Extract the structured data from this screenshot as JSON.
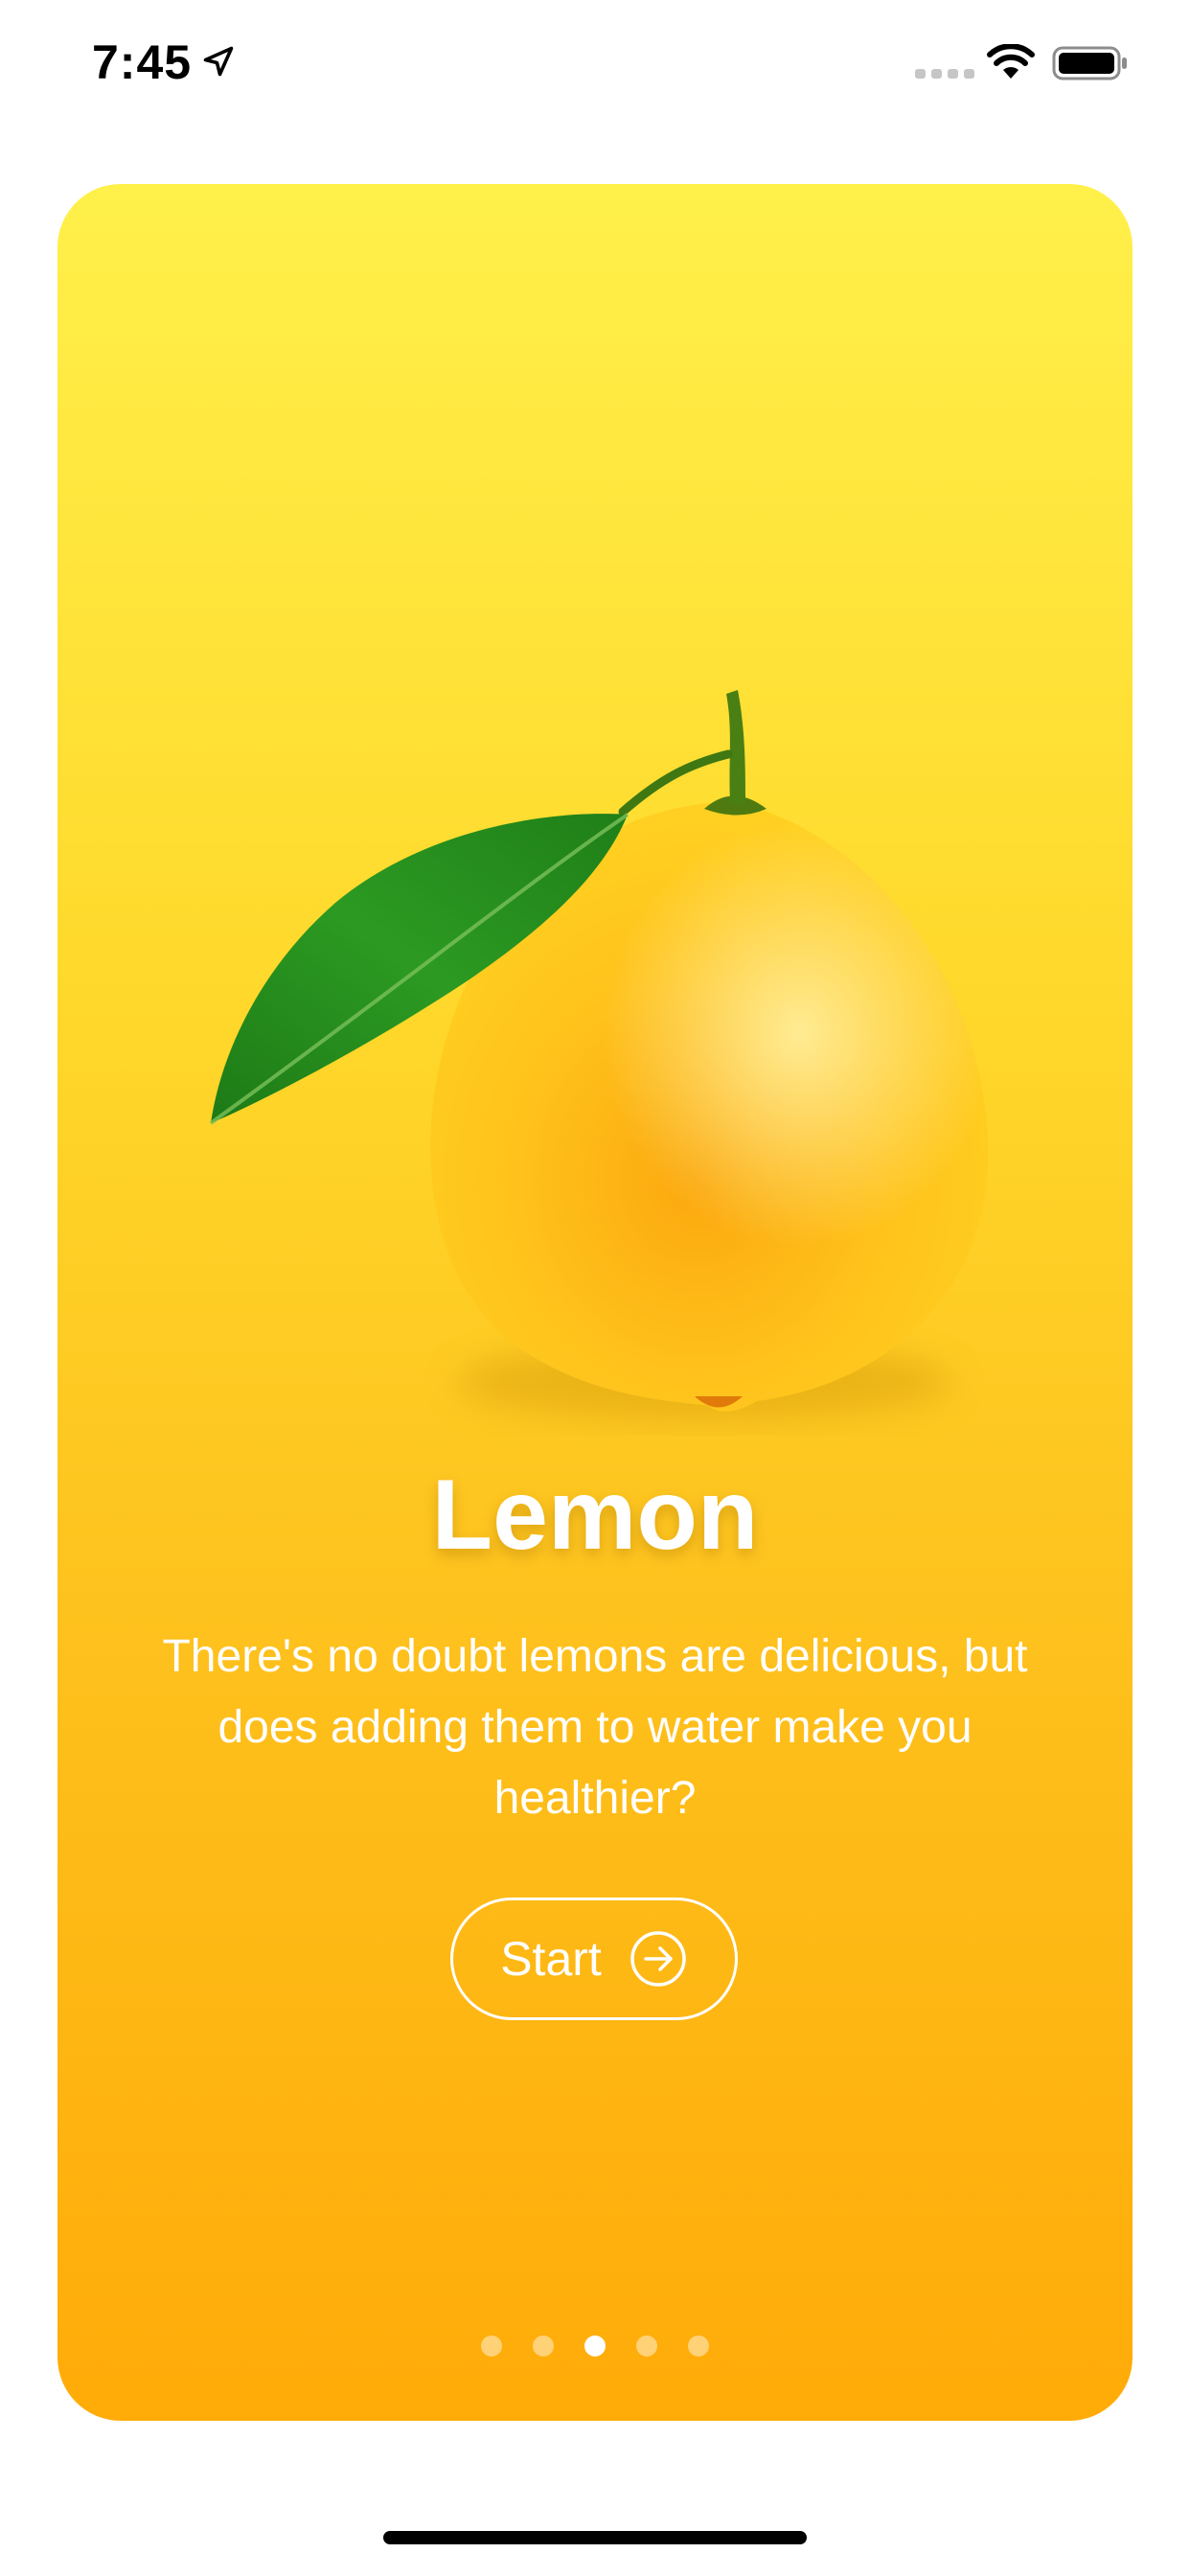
{
  "status_bar": {
    "time": "7:45",
    "icons": [
      "location-arrow-icon",
      "cellular-signal-icon",
      "wifi-icon",
      "battery-icon"
    ]
  },
  "card": {
    "title": "Lemon",
    "description": "There's no doubt lemons are delicious, but does adding them to water make you healthier?",
    "start_label": "Start",
    "image": "lemon-with-leaf",
    "pagination": {
      "total": 5,
      "active_index": 2
    },
    "colors": {
      "gradient_top": "#fff04a",
      "gradient_bottom": "#ffab08",
      "text": "#ffffff"
    }
  }
}
